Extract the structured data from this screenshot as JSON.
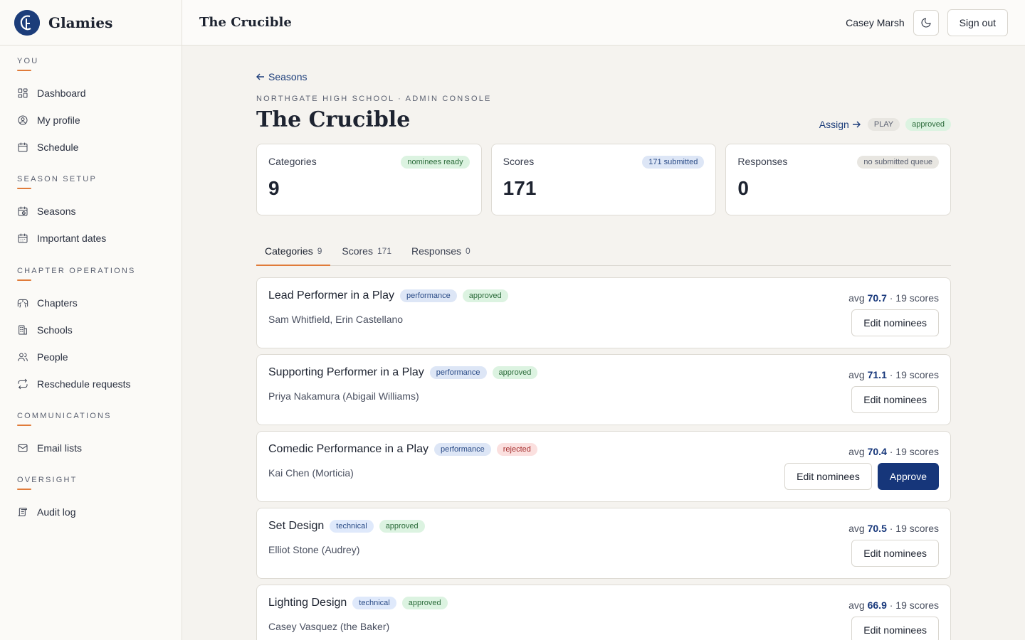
{
  "brand": {
    "name": "Glamies"
  },
  "sidebar": {
    "sections": [
      {
        "title": "You",
        "items": [
          {
            "label": "Dashboard",
            "icon": "dashboard-icon"
          },
          {
            "label": "My profile",
            "icon": "user-circle-icon"
          },
          {
            "label": "Schedule",
            "icon": "calendar-icon"
          }
        ]
      },
      {
        "title": "Season setup",
        "items": [
          {
            "label": "Seasons",
            "icon": "calendar-clock-icon"
          },
          {
            "label": "Important dates",
            "icon": "calendar-grid-icon"
          }
        ]
      },
      {
        "title": "Chapter operations",
        "items": [
          {
            "label": "Chapters",
            "icon": "theater-icon"
          },
          {
            "label": "Schools",
            "icon": "building-icon"
          },
          {
            "label": "People",
            "icon": "users-icon"
          },
          {
            "label": "Reschedule requests",
            "icon": "repeat-icon"
          }
        ]
      },
      {
        "title": "Communications",
        "items": [
          {
            "label": "Email lists",
            "icon": "mail-icon"
          }
        ]
      },
      {
        "title": "Oversight",
        "items": [
          {
            "label": "Audit log",
            "icon": "scroll-icon"
          }
        ]
      }
    ]
  },
  "header": {
    "title": "The Crucible",
    "user": "Casey Marsh",
    "theme_icon": "moon-icon",
    "sign_out": "Sign out"
  },
  "page": {
    "back_label": "Seasons",
    "eyebrow": "Northgate High School · Admin Console",
    "title": "The Crucible",
    "assign_label": "Assign",
    "type_badge": "PLAY",
    "status_badge": "approved"
  },
  "stats": [
    {
      "label": "Categories",
      "badge": "nominees ready",
      "value": "9"
    },
    {
      "label": "Scores",
      "badge": "171 submitted",
      "value": "171"
    },
    {
      "label": "Responses",
      "badge": "no submitted queue",
      "value": "0"
    }
  ],
  "tabs": [
    {
      "label": "Categories",
      "count": "9"
    },
    {
      "label": "Scores",
      "count": "171"
    },
    {
      "label": "Responses",
      "count": "0"
    }
  ],
  "categories": [
    {
      "title": "Lead Performer in a Play",
      "type": "performance",
      "status": "approved",
      "nominees": "Sam Whitfield, Erin Castellano",
      "avg_prefix": "avg",
      "avg": "70.7",
      "scores": "· 19 scores",
      "edit_label": "Edit nominees",
      "approve_label": ""
    },
    {
      "title": "Supporting Performer in a Play",
      "type": "performance",
      "status": "approved",
      "nominees": "Priya Nakamura (Abigail Williams)",
      "avg_prefix": "avg",
      "avg": "71.1",
      "scores": "· 19 scores",
      "edit_label": "Edit nominees",
      "approve_label": ""
    },
    {
      "title": "Comedic Performance in a Play",
      "type": "performance",
      "status": "rejected",
      "nominees": "Kai Chen (Morticia)",
      "avg_prefix": "avg",
      "avg": "70.4",
      "scores": "· 19 scores",
      "edit_label": "Edit nominees",
      "approve_label": "Approve"
    },
    {
      "title": "Set Design",
      "type": "technical",
      "status": "approved",
      "nominees": "Elliot Stone (Audrey)",
      "avg_prefix": "avg",
      "avg": "70.5",
      "scores": "· 19 scores",
      "edit_label": "Edit nominees",
      "approve_label": ""
    },
    {
      "title": "Lighting Design",
      "type": "technical",
      "status": "approved",
      "nominees": "Casey Vasquez (the Baker)",
      "avg_prefix": "avg",
      "avg": "66.9",
      "scores": "· 19 scores",
      "edit_label": "Edit nominees",
      "approve_label": ""
    }
  ],
  "colors": {
    "accent": "#e07b39",
    "primary": "#16367a",
    "link": "#1c3d7a"
  }
}
